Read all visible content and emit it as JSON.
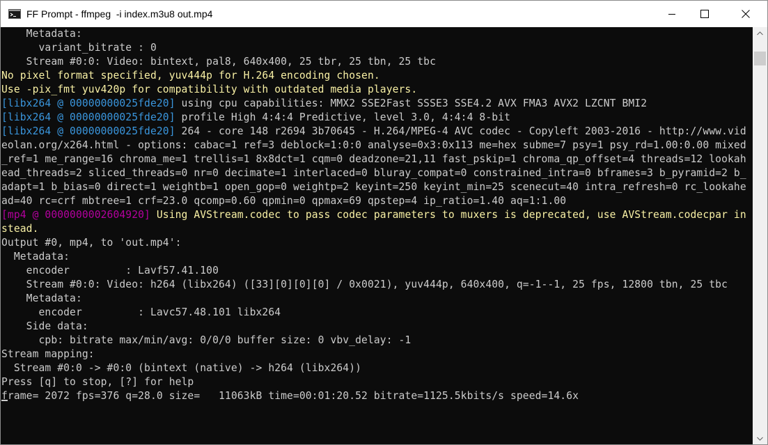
{
  "window": {
    "title": "FF Prompt - ffmpeg  -i index.m3u8 out.mp4",
    "icon": "console-icon",
    "controls": {
      "minimize": "minimize-icon",
      "maximize": "maximize-icon",
      "close": "close-icon"
    }
  },
  "colors": {
    "default_text": "#cccccc",
    "warning_text": "#f9f1a5",
    "libx264_tag": "#3a96dd",
    "mp4_tag": "#b4009e",
    "background": "#0c0c0c"
  },
  "console": {
    "lines": [
      {
        "segments": [
          {
            "text": "    Metadata:",
            "color": "gray"
          }
        ]
      },
      {
        "segments": [
          {
            "text": "      variant_bitrate : 0",
            "color": "gray"
          }
        ]
      },
      {
        "segments": [
          {
            "text": "    Stream #0:0: Video: bintext, pal8, 640x400, 25 tbr, 25 tbn, 25 tbc",
            "color": "gray"
          }
        ]
      },
      {
        "segments": [
          {
            "text": "No pixel format specified, yuv444p for H.264 encoding chosen.",
            "color": "yellow"
          }
        ]
      },
      {
        "segments": [
          {
            "text": "Use -pix_fmt yuv420p for compatibility with outdated media players.",
            "color": "yellow"
          }
        ]
      },
      {
        "segments": [
          {
            "text": "[libx264 @ 00000000025fde20]",
            "color": "cyan"
          },
          {
            "text": " using cpu capabilities: MMX2 SSE2Fast SSSE3 SSE4.2 AVX FMA3 AVX2 LZCNT BMI2",
            "color": "gray"
          }
        ]
      },
      {
        "segments": [
          {
            "text": "[libx264 @ 00000000025fde20]",
            "color": "cyan"
          },
          {
            "text": " profile High 4:4:4 Predictive, level 3.0, 4:4:4 8-bit",
            "color": "gray"
          }
        ]
      },
      {
        "segments": [
          {
            "text": "[libx264 @ 00000000025fde20]",
            "color": "cyan"
          },
          {
            "text": " 264 - core 148 r2694 3b70645 - H.264/MPEG-4 AVC codec - Copyleft 2003-2016 - http://www.vid",
            "color": "gray"
          }
        ]
      },
      {
        "segments": [
          {
            "text": "eolan.org/x264.html - options: cabac=1 ref=3 deblock=1:0:0 analyse=0x3:0x113 me=hex subme=7 psy=1 psy_rd=1.00:0.00 mixed",
            "color": "gray"
          }
        ]
      },
      {
        "segments": [
          {
            "text": "_ref=1 me_range=16 chroma_me=1 trellis=1 8x8dct=1 cqm=0 deadzone=21,11 fast_pskip=1 chroma_qp_offset=4 threads=12 lookah",
            "color": "gray"
          }
        ]
      },
      {
        "segments": [
          {
            "text": "ead_threads=2 sliced_threads=0 nr=0 decimate=1 interlaced=0 bluray_compat=0 constrained_intra=0 bframes=3 b_pyramid=2 b_",
            "color": "gray"
          }
        ]
      },
      {
        "segments": [
          {
            "text": "adapt=1 b_bias=0 direct=1 weightb=1 open_gop=0 weightp=2 keyint=250 keyint_min=25 scenecut=40 intra_refresh=0 rc_lookahe",
            "color": "gray"
          }
        ]
      },
      {
        "segments": [
          {
            "text": "ad=40 rc=crf mbtree=1 crf=23.0 qcomp=0.60 qpmin=0 qpmax=69 qpstep=4 ip_ratio=1.40 aq=1:1.00",
            "color": "gray"
          }
        ]
      },
      {
        "segments": [
          {
            "text": "[mp4 @ 0000000002604920]",
            "color": "mag"
          },
          {
            "text": " Using AVStream.codec to pass codec parameters to muxers is deprecated, use AVStream.codecpar in",
            "color": "yellow"
          }
        ]
      },
      {
        "segments": [
          {
            "text": "stead.",
            "color": "yellow"
          }
        ]
      },
      {
        "segments": [
          {
            "text": "Output #0, mp4, to 'out.mp4':",
            "color": "gray"
          }
        ]
      },
      {
        "segments": [
          {
            "text": "  Metadata:",
            "color": "gray"
          }
        ]
      },
      {
        "segments": [
          {
            "text": "    encoder         : Lavf57.41.100",
            "color": "gray"
          }
        ]
      },
      {
        "segments": [
          {
            "text": "    Stream #0:0: Video: h264 (libx264) ([33][0][0][0] / 0x0021), yuv444p, 640x400, q=-1--1, 25 fps, 12800 tbn, 25 tbc",
            "color": "gray"
          }
        ]
      },
      {
        "segments": [
          {
            "text": "    Metadata:",
            "color": "gray"
          }
        ]
      },
      {
        "segments": [
          {
            "text": "      encoder         : Lavc57.48.101 libx264",
            "color": "gray"
          }
        ]
      },
      {
        "segments": [
          {
            "text": "    Side data:",
            "color": "gray"
          }
        ]
      },
      {
        "segments": [
          {
            "text": "      cpb: bitrate max/min/avg: 0/0/0 buffer size: 0 vbv_delay: -1",
            "color": "gray"
          }
        ]
      },
      {
        "segments": [
          {
            "text": "Stream mapping:",
            "color": "gray"
          }
        ]
      },
      {
        "segments": [
          {
            "text": "  Stream #0:0 -> #0:0 (bintext (native) -> h264 (libx264))",
            "color": "gray"
          }
        ]
      },
      {
        "segments": [
          {
            "text": "Press [q] to stop, [?] for help",
            "color": "gray"
          }
        ]
      },
      {
        "segments": [
          {
            "text": "frame= 2072 fps=376 q=28.0 size=   11063kB time=00:01:20.52 bitrate=1125.5kbits/s speed=14.6x",
            "color": "gray"
          }
        ]
      }
    ]
  },
  "scrollbar": {
    "up": "scroll-up-arrow-icon",
    "down": "scroll-down-arrow-icon"
  }
}
